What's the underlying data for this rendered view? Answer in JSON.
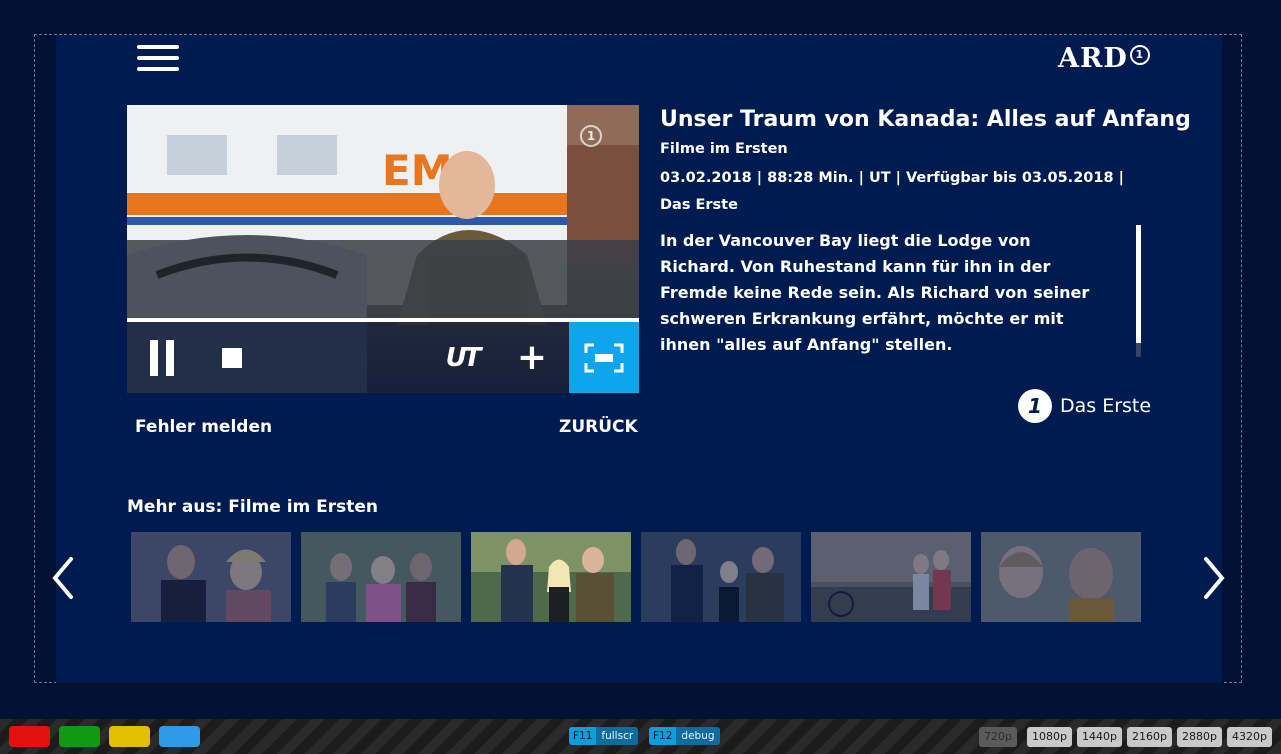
{
  "header": {
    "menu_icon": "hamburger-menu-icon",
    "logo_text": "ARD",
    "logo_digit": "1"
  },
  "player": {
    "sender_digit": "1",
    "progress": 1.0,
    "controls": {
      "pause_icon": "pause-icon",
      "stop_icon": "stop-icon",
      "subtitles_label": "UT",
      "add_label": "+",
      "fullscreen_icon": "fullscreen-icon"
    }
  },
  "actions": {
    "report_label": "Fehler melden",
    "back_label": "ZURÜCK"
  },
  "details": {
    "title": "Unser Traum von Kanada: Alles auf Anfang",
    "category": "Filme im Ersten",
    "meta": "03.02.2018 | 88:28 Min. | UT | Verfügbar bis 03.05.2018 | Das Erste",
    "description": "In der Vancouver Bay liegt die Lodge von Richard. Von Ruhestand kann für ihn in der Fremde keine Rede sein. Als Richard von seiner schweren Erkrankung erfährt, möchte er mit ihnen \"alles auf Anfang\" stellen.",
    "scroll_position": 0.0,
    "sender_logo_digit": "1",
    "sender_logo_name": "Das Erste"
  },
  "more": {
    "title": "Mehr aus: Filme im Ersten",
    "thumbnail_count": 6,
    "active_index": 2
  },
  "bottom_bar": {
    "color_buttons": [
      "#e31212",
      "#0f9a11",
      "#e2c000",
      "#2f9ae8"
    ],
    "keys": [
      {
        "key": "F11",
        "label": "fullscr"
      },
      {
        "key": "F12",
        "label": "debug"
      }
    ],
    "resolutions": [
      "720p",
      "1080p",
      "1440p",
      "2160p",
      "2880p",
      "4320p"
    ],
    "inactive_resolution": "720p"
  }
}
